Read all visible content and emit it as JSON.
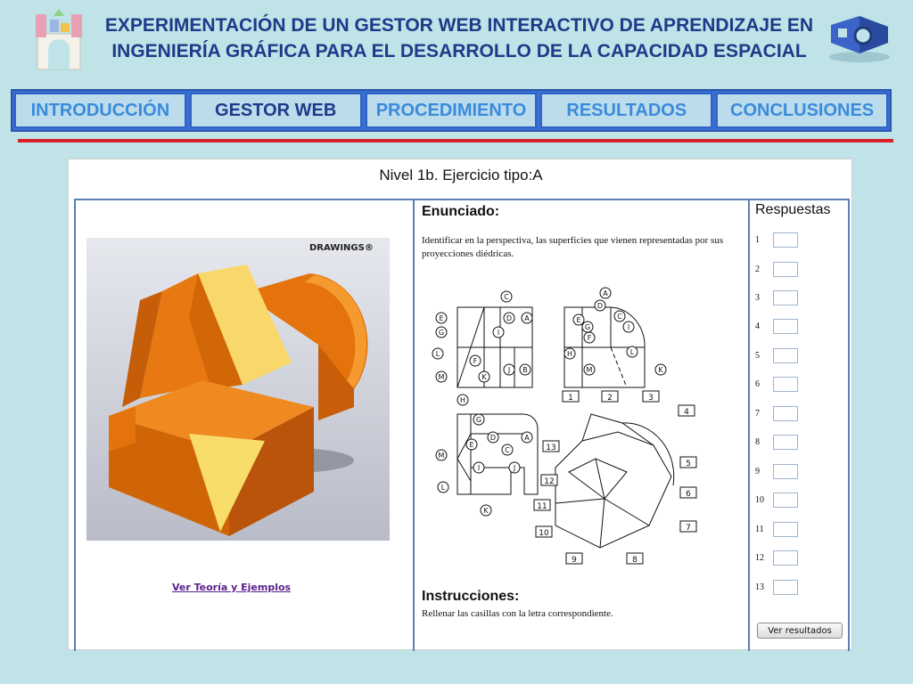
{
  "header": {
    "title": "EXPERIMENTACIÓN DE UN GESTOR WEB INTERACTIVO DE APRENDIZAJE EN INGENIERÍA GRÁFICA PARA EL DESARROLLO DE LA CAPACIDAD ESPACIAL",
    "left_logo": "building-blocks-logo",
    "right_logo": "3d-shape-logo"
  },
  "nav": {
    "tabs": [
      {
        "label": "INTRODUCCIÓN",
        "active": false
      },
      {
        "label": "GESTOR WEB",
        "active": true
      },
      {
        "label": "PROCEDIMIENTO",
        "active": false
      },
      {
        "label": "RESULTADOS",
        "active": false
      },
      {
        "label": "CONCLUSIONES",
        "active": false
      }
    ]
  },
  "exercise": {
    "title": "Nivel 1b. Ejercicio tipo:A",
    "watermark": "DRAWINGS®",
    "theory_link": "Ver Teoría y Ejemplos",
    "statement_heading": "Enunciado:",
    "statement_text": "Identificar en la perspectiva, las superficies que vienen representadas por sus proyecciones diédricas.",
    "instructions_heading": "Instrucciones:",
    "instructions_text": "Rellenar las casillas con la letra correspondiente.",
    "answers_heading": "Respuestas",
    "answers": [
      "1",
      "2",
      "3",
      "4",
      "5",
      "6",
      "7",
      "8",
      "9",
      "10",
      "11",
      "12",
      "13"
    ],
    "view_letters_front": [
      "C",
      "E",
      "D",
      "A",
      "G",
      "I",
      "L",
      "F",
      "M",
      "K",
      "J",
      "B"
    ],
    "view_letters_side": [
      "A",
      "D",
      "C",
      "E",
      "G",
      "F",
      "I",
      "H",
      "L",
      "M",
      "K"
    ],
    "view_letters_top": [
      "H",
      "G",
      "E",
      "D",
      "A",
      "C",
      "M",
      "I",
      "J",
      "L",
      "K"
    ],
    "perspective_numbers": [
      "1",
      "2",
      "3",
      "4",
      "13",
      "5",
      "12",
      "6",
      "11",
      "7",
      "10",
      "9",
      "8"
    ],
    "submit_label": "Ver resultados"
  },
  "colors": {
    "background": "#bfe3e6",
    "title_text": "#1f3a8a",
    "nav_active": "#1f3a8a",
    "nav_inactive": "#3a8bdc",
    "accent_line": "#d8222c",
    "model_orange": "#e8770f",
    "model_highlight": "#f5e07a"
  }
}
